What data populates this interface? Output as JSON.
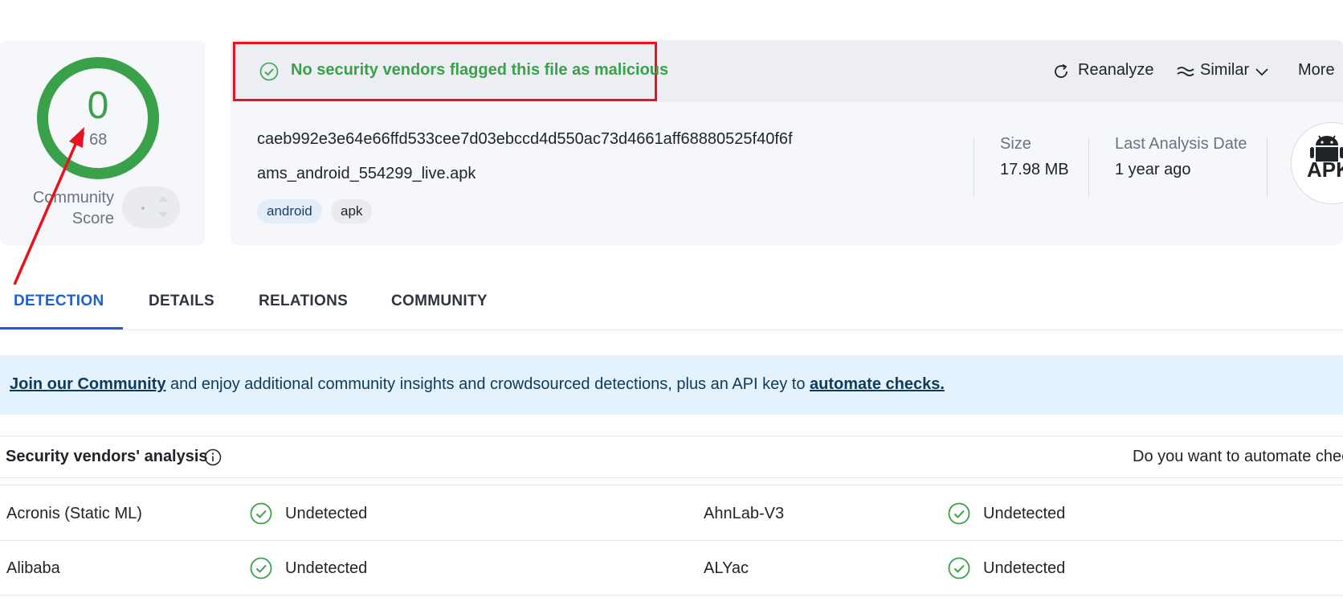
{
  "score": {
    "value": "0",
    "total": "/ 68",
    "community_label_line1": "Community",
    "community_label_line2": "Score",
    "vote_value": "-"
  },
  "header": {
    "status": "No security vendors flagged this file as malicious",
    "actions": {
      "reanalyze": "Reanalyze",
      "similar": "Similar",
      "more": "More"
    }
  },
  "file": {
    "hash": "caeb992e3e64e66ffd533cee7d03ebccd4d550ac73d4661aff68880525f40f6f",
    "name": "ams_android_554299_live.apk",
    "tags": [
      "android",
      "apk"
    ],
    "size_label": "Size",
    "size_value": "17.98 MB",
    "date_label": "Last Analysis Date",
    "date_value": "1 year ago",
    "type_badge": "APK"
  },
  "tabs": [
    "DETECTION",
    "DETAILS",
    "RELATIONS",
    "COMMUNITY"
  ],
  "active_tab": "DETECTION",
  "banner": {
    "link1": "Join our Community",
    "text": " and enjoy additional community insights and crowdsourced detections, plus an API key to ",
    "link2": "automate checks."
  },
  "vendors": {
    "title": "Security vendors' analysis",
    "cta": "Do you want to automate checks?",
    "rows": [
      {
        "left_name": "Acronis (Static ML)",
        "left_result": "Undetected",
        "right_name": "AhnLab-V3",
        "right_result": "Undetected"
      },
      {
        "left_name": "Alibaba",
        "left_result": "Undetected",
        "right_name": "ALYac",
        "right_result": "Undetected"
      }
    ]
  },
  "colors": {
    "accent_green": "#3aa14b",
    "tab_active_blue": "#1e5fd1",
    "highlight_red": "#e5141e",
    "annotation_arrow_red": "#e5141e"
  }
}
